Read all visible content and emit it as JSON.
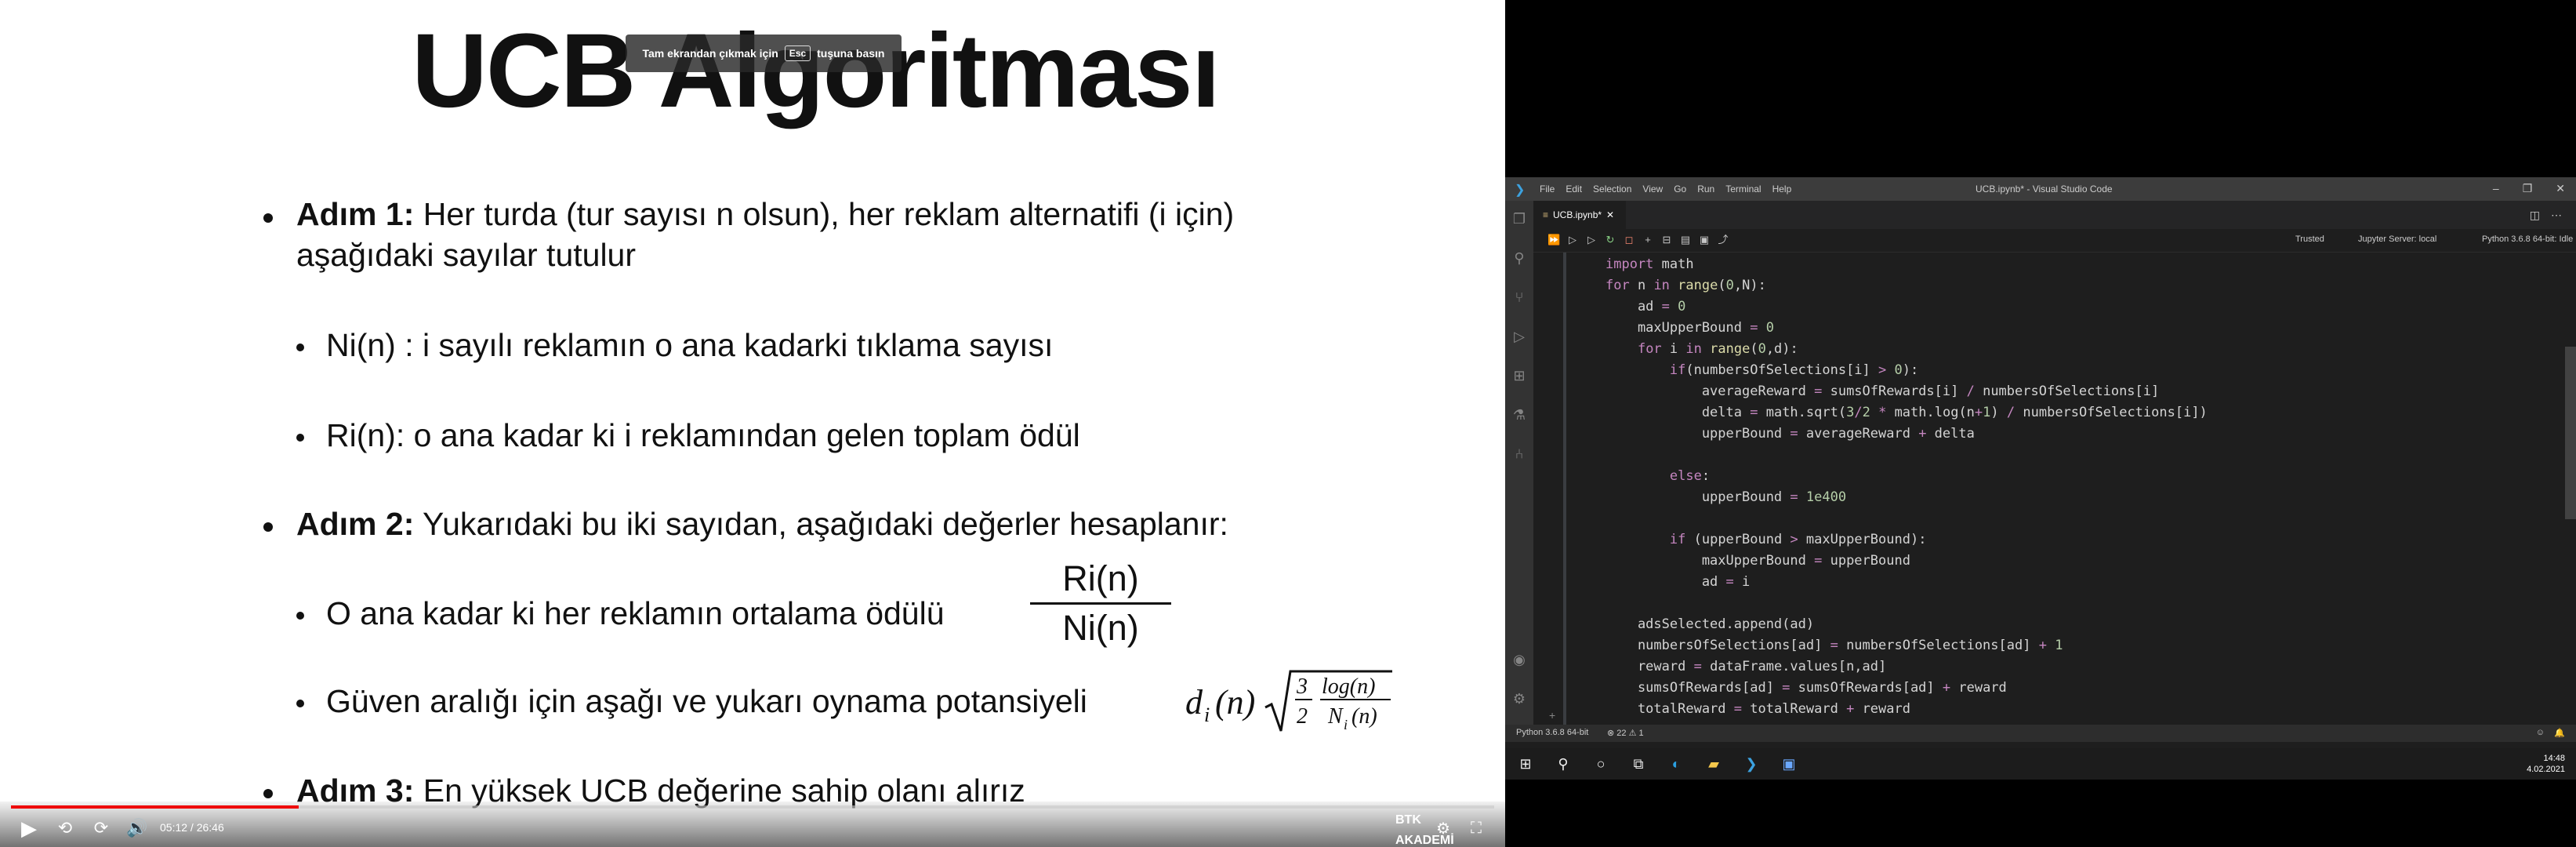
{
  "video": {
    "slide_title": "UCB Algoritması",
    "esc_toast": {
      "before": "Tam ekrandan çıkmak için",
      "key": "Esc",
      "after": "tuşuna basın"
    },
    "bullet1_bold": "Adım 1:",
    "bullet1_text": " Her turda (tur sayısı n olsun), her reklam alternatifi (i için)",
    "bullet1_line2": "aşağıdaki sayılar tutulur",
    "sub1": "Ni(n) : i sayılı reklamın o ana kadarki tıklama sayısı",
    "sub2": "Ri(n): o ana kadar ki i reklamından gelen toplam ödül",
    "bullet2_bold": "Adım 2:",
    "bullet2_text": " Yukarıdaki bu iki sayıdan, aşağıdaki değerler hesaplanır:",
    "sub3": "O ana kadar ki her reklamın ortalama ödülü",
    "frac_num": "Ri(n)",
    "frac_den": "Ni(n)",
    "sub4": "Güven aralığı için aşağı ve yukarı oynama potansiyeli",
    "formula": {
      "d": "d",
      "i": "i",
      "n": "(n)",
      "three": "3",
      "two": "2",
      "log": "log(n)",
      "N": "N",
      "Ni_sub": "i",
      "Nn": "(n)"
    },
    "bullet3_bold": "Adım 3:",
    "bullet3_text": " En yüksek UCB değerine sahip olanı alırız",
    "time_display": "05:12 / 26:46",
    "progress": 0.194,
    "logo": "BTK AKADEMİ"
  },
  "vscode": {
    "menu": [
      "File",
      "Edit",
      "Selection",
      "View",
      "Go",
      "Run",
      "Terminal",
      "Help"
    ],
    "window_title": "UCB.ipynb* - Visual Studio Code",
    "tab_label": "UCB.ipynb*",
    "trusted": "Trusted",
    "jupyter_server": "Jupyter Server: local",
    "kernel": "Python 3.6.8 64-bit: Idle",
    "status_python": "Python 3.6.8 64-bit",
    "status_problems": "⊗ 22 ⚠ 1",
    "clock_time": "14:48",
    "clock_date": "4.02.2021"
  }
}
